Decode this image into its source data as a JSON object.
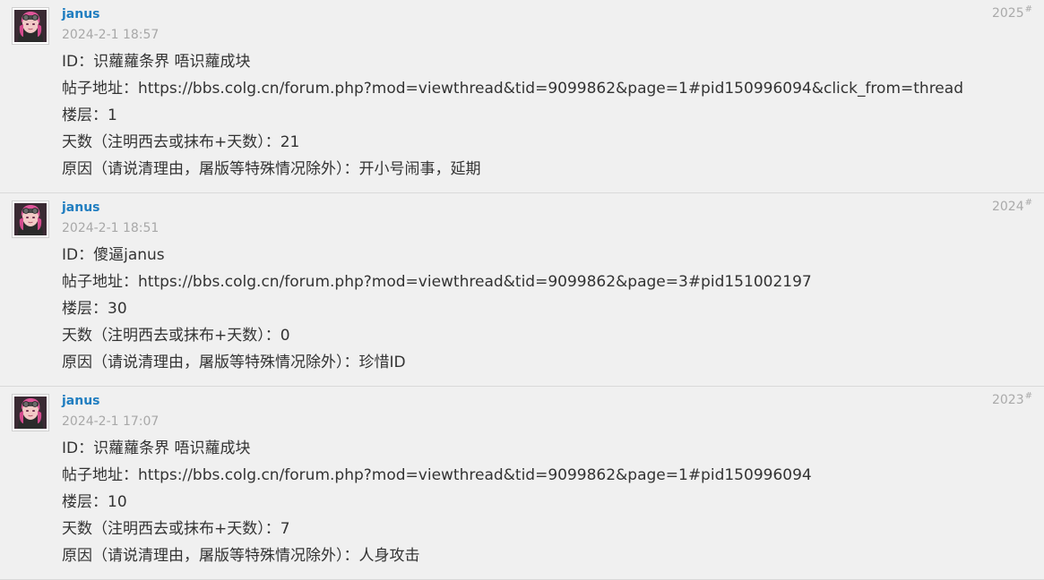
{
  "posts": [
    {
      "username": "janus",
      "timestamp": "2024-2-1 18:57",
      "floor_number": "2025",
      "floor_hash": "#",
      "lines": [
        "ID：识蘿蘿条界 唔识蘿成块",
        "帖子地址：https://bbs.colg.cn/forum.php?mod=viewthread&tid=9099862&page=1#pid150996094&click_from=thread",
        "楼层：1",
        "天数（注明西去或抹布+天数）：21",
        "原因（请说清理由，屠版等特殊情况除外）：开小号闹事，延期"
      ]
    },
    {
      "username": "janus",
      "timestamp": "2024-2-1 18:51",
      "floor_number": "2024",
      "floor_hash": "#",
      "lines": [
        "ID：傻逼janus",
        "帖子地址：https://bbs.colg.cn/forum.php?mod=viewthread&tid=9099862&page=3#pid151002197",
        "楼层：30",
        "天数（注明西去或抹布+天数）：0",
        "原因（请说清理由，屠版等特殊情况除外）：珍惜ID"
      ]
    },
    {
      "username": "janus",
      "timestamp": "2024-2-1 17:07",
      "floor_number": "2023",
      "floor_hash": "#",
      "lines": [
        "ID：识蘿蘿条界 唔识蘿成块",
        "帖子地址：https://bbs.colg.cn/forum.php?mod=viewthread&tid=9099862&page=1#pid150996094",
        "楼层：10",
        "天数（注明西去或抹布+天数）：7",
        "原因（请说清理由，屠版等特殊情况除外）：人身攻击"
      ]
    }
  ],
  "colors": {
    "background": "#f0f0f0",
    "username": "#1f7dc0",
    "timestamp": "#a8a8a8",
    "floor": "#aaaaaa",
    "body_text": "#333333",
    "divider": "#d9d9d9"
  },
  "icons": {
    "avatar": "user-avatar-icon"
  }
}
